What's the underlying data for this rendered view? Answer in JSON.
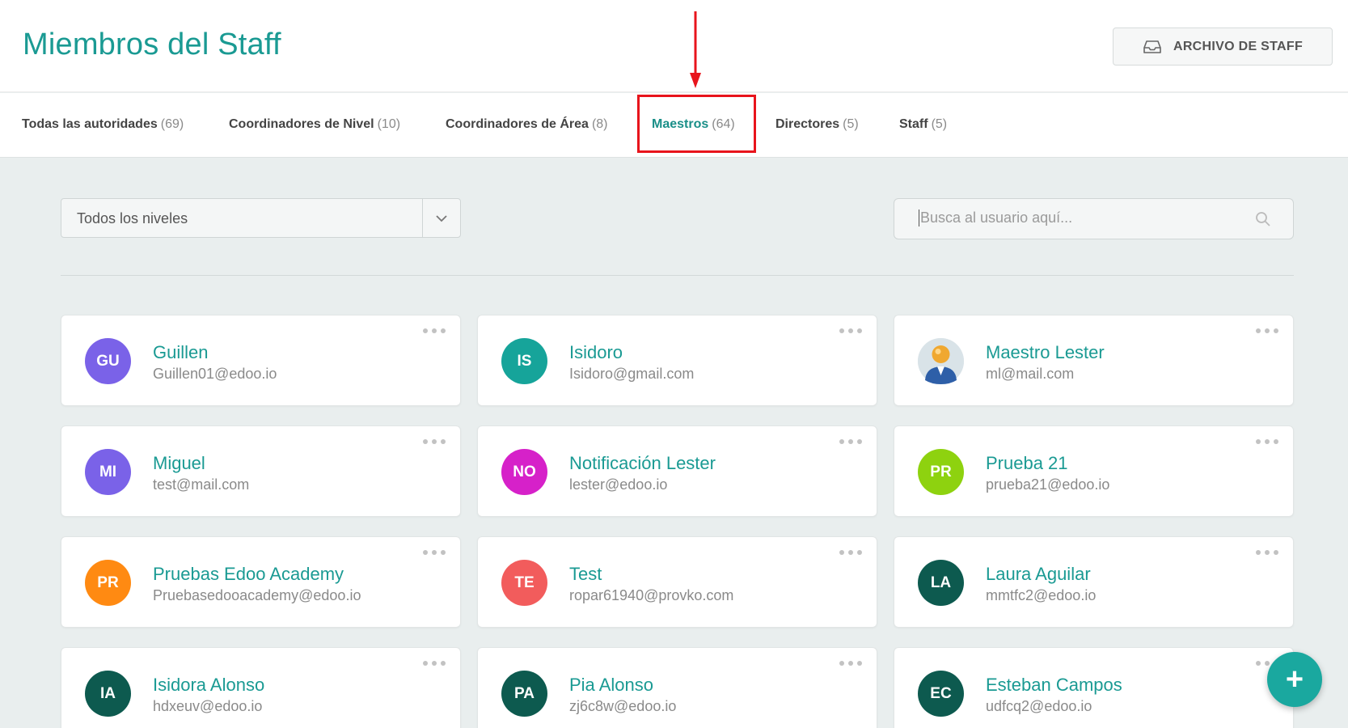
{
  "header": {
    "title": "Miembros del Staff",
    "archive_button": "ARCHIVO DE STAFF"
  },
  "tabs": [
    {
      "label": "Todas las autoridades",
      "count": "(69)",
      "active": false
    },
    {
      "label": "Coordinadores de Nivel",
      "count": "(10)",
      "active": false
    },
    {
      "label": "Coordinadores de Área",
      "count": "(8)",
      "active": false
    },
    {
      "label": "Maestros",
      "count": "(64)",
      "active": true
    },
    {
      "label": "Directores",
      "count": "(5)",
      "active": false
    },
    {
      "label": "Staff",
      "count": "(5)",
      "active": false
    }
  ],
  "filter": {
    "selected": "Todos los niveles"
  },
  "search": {
    "placeholder": "Busca al usuario aquí..."
  },
  "members": [
    {
      "initials": "GU",
      "name": "Guillen",
      "email": "Guillen01@edoo.io",
      "color": "#7a62e8"
    },
    {
      "initials": "IS",
      "name": "Isidoro",
      "email": "Isidoro@gmail.com",
      "color": "#16a49a"
    },
    {
      "initials": "",
      "name": "Maestro Lester",
      "email": "ml@mail.com",
      "color": "photo",
      "icon": "user-photo-icon"
    },
    {
      "initials": "MI",
      "name": "Miguel",
      "email": "test@mail.com",
      "color": "#7a62e8"
    },
    {
      "initials": "NO",
      "name": "Notificación Lester",
      "email": "lester@edoo.io",
      "color": "#d621c9"
    },
    {
      "initials": "PR",
      "name": "Prueba 21",
      "email": "prueba21@edoo.io",
      "color": "#8ed20f"
    },
    {
      "initials": "PR",
      "name": "Pruebas Edoo Academy",
      "email": "Pruebasedooacademy@edoo.io",
      "color": "#ff8a12"
    },
    {
      "initials": "TE",
      "name": "Test",
      "email": "ropar61940@provko.com",
      "color": "#f25c5c"
    },
    {
      "initials": "LA",
      "name": "Laura Aguilar",
      "email": "mmtfc2@edoo.io",
      "color": "#0d5a4f"
    },
    {
      "initials": "IA",
      "name": "Isidora Alonso",
      "email": "hdxeuv@edoo.io",
      "color": "#0d5a4f"
    },
    {
      "initials": "PA",
      "name": "Pia Alonso",
      "email": "zj6c8w@edoo.io",
      "color": "#0d5a4f"
    },
    {
      "initials": "EC",
      "name": "Esteban Campos",
      "email": "udfcq2@edoo.io",
      "color": "#0d5a4f"
    }
  ],
  "fab": {
    "label": "+"
  },
  "colors": {
    "accent": "#1a9a93",
    "highlight": "#e8141c"
  }
}
